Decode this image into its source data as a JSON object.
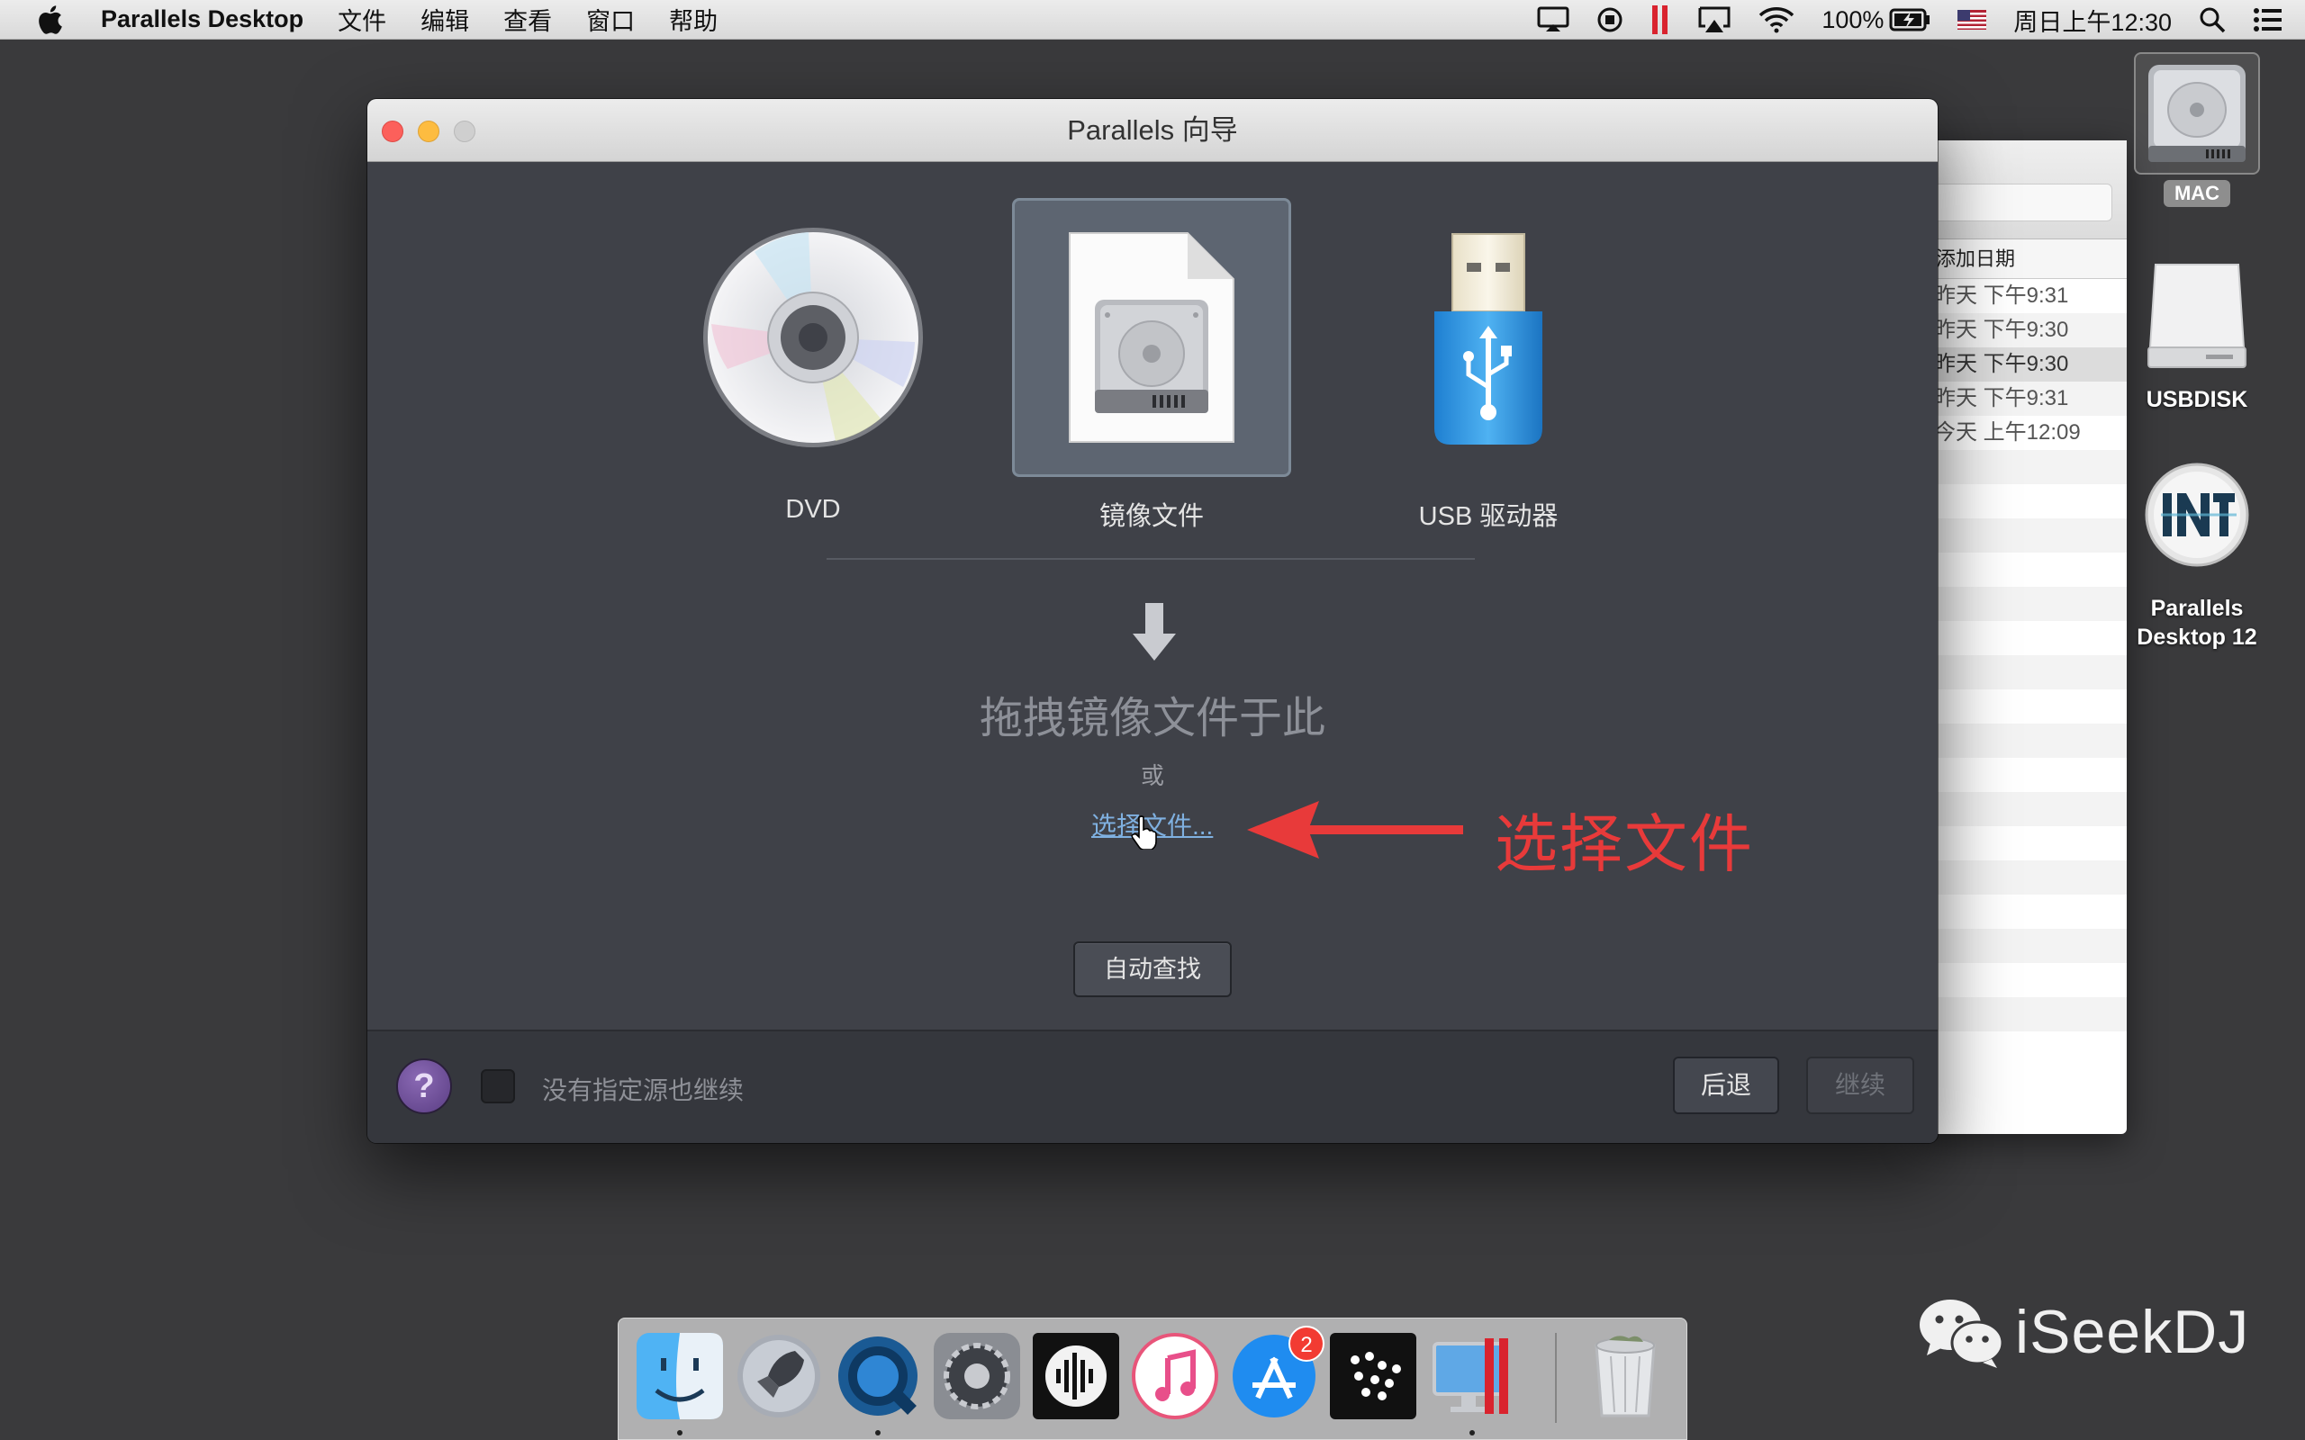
{
  "menubar": {
    "app_name": "Parallels Desktop",
    "menus": [
      "文件",
      "编辑",
      "查看",
      "窗口",
      "帮助"
    ],
    "battery": "100%",
    "clock": "周日上午12:30",
    "status_icons": [
      "display-icon",
      "record-icon",
      "parallels-icon",
      "airplay-icon",
      "wifi-icon",
      "battery-icon",
      "flag-icon",
      "spotlight-icon",
      "notification-icon"
    ]
  },
  "back_window": {
    "column_header": "添加日期",
    "rows": [
      "昨天 下午9:31",
      "昨天 下午9:30",
      "昨天 下午9:30",
      "昨天 下午9:31",
      "今天 上午12:09"
    ]
  },
  "dialog": {
    "title": "Parallels 向导",
    "sources": [
      {
        "label": "DVD",
        "icon": "dvd-icon",
        "selected": false
      },
      {
        "label": "镜像文件",
        "icon": "disk-image-icon",
        "selected": true
      },
      {
        "label": "USB 驱动器",
        "icon": "usb-drive-icon",
        "selected": false
      }
    ],
    "drop_text": "拖拽镜像文件于此",
    "or_text": "或",
    "choose_file": "选择文件...",
    "auto_find": "自动查找",
    "footer": {
      "help": "?",
      "checkbox_label": "没有指定源也继续",
      "checkbox_checked": false,
      "back": "后退",
      "continue": "继续"
    }
  },
  "annotation": {
    "text": "选择文件",
    "color": "#e83a3a"
  },
  "desktop_icons": [
    {
      "name": "MAC",
      "icon": "hard-drive-icon"
    },
    {
      "name": "USBDISK",
      "icon": "external-drive-icon"
    },
    {
      "name": "Parallels Desktop 12",
      "icon": "installer-icon"
    }
  ],
  "dock": {
    "items": [
      "finder-icon",
      "launchpad-icon",
      "quicktime-icon",
      "system-preferences-icon",
      "audio-app-icon",
      "itunes-icon",
      "app-store-icon",
      "dots-app-icon",
      "parallels-desktop-icon",
      "trash-icon"
    ],
    "app_store_badge": "2"
  },
  "watermark": "iSeekDJ"
}
